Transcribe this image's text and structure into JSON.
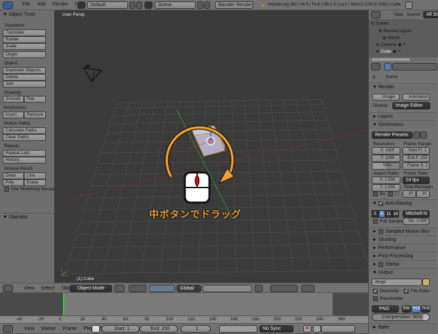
{
  "top": {
    "menus": [
      "File",
      "Add",
      "Render",
      "Help"
    ],
    "layout": "Default",
    "scene": "Scene",
    "engine": "Blender Render",
    "info": "blender.org 262 | Ve:8 | Fa:6 | Ob:1-3 | La:1 | Mem:5.17M (0.10M) | Cube"
  },
  "tools": {
    "title": "Object Tools",
    "transform": "Transform:",
    "translate": "Translate",
    "rotate": "Rotate",
    "scale": "Scale",
    "origin": "Origin",
    "object": "Object:",
    "duplicate": "Duplicate Objects",
    "delete": "Delete",
    "join": "Join",
    "shading": "Shading:",
    "smooth": "Smooth",
    "flat": "Flat",
    "keyframes": "Keyframes:",
    "insert": "Insert",
    "remove": "Remove",
    "motion": "Motion Paths:",
    "calc": "Calculate Paths",
    "clear": "Clear Paths",
    "repeat": "Repeat:",
    "repeat_last": "Repeat Last",
    "history": "History...",
    "grease": "Grease Pencil:",
    "draw": "Draw",
    "line": "Line",
    "poly": "Poly",
    "erase": "Erase",
    "sketch": "Use Sketching Sessio",
    "operator": "Operator"
  },
  "viewport": {
    "label": "User Persp",
    "object_label": "(1) Cube",
    "overlay_text": "中ボタンでドラッグ",
    "accent": "#f0a030"
  },
  "view_header": {
    "menus": [
      "View",
      "Select",
      "Object"
    ],
    "mode": "Object Mode",
    "orientation": "Global"
  },
  "timeline": {
    "ticks": [
      "-40",
      "-20",
      "0",
      "20",
      "40",
      "60",
      "80",
      "100",
      "120",
      "140",
      "160",
      "180",
      "200",
      "220",
      "240",
      "260"
    ],
    "menus": [
      "View",
      "Marker",
      "Frame",
      "Playback"
    ],
    "start": "Start: 1",
    "end": "End: 250",
    "current": "1",
    "sync": "No Sync"
  },
  "outliner": {
    "menus": [
      "View",
      "Search"
    ],
    "filter": "All Scenes",
    "items": [
      "Scene",
      "RenderLayers",
      "World",
      "Camera",
      "Cube"
    ]
  },
  "props": {
    "scene": "Scene",
    "render": "Render",
    "image": "Image",
    "animation": "Animation",
    "display_label": "Display:",
    "display": "Image Editor",
    "layers": "Layers",
    "dimensions": "Dimensions",
    "presets": "Render Presets",
    "resolution": "Resolution:",
    "res_x": "X: 1920",
    "res_y": "Y: 1080",
    "res_pct": "50%",
    "frame_range": "Frame Range:",
    "start": "Start Fr: 1",
    "end": "End F: 250",
    "step": "Frame S: 1",
    "aspect": "Aspect Ratio:",
    "asp_x": "X: 1.000",
    "asp_y": "Y: 1.000",
    "frame_rate": "Frame Rate:",
    "fps": "24 fps",
    "remap": "Time Remappi",
    "remap_old": "10",
    "remap_new": "10",
    "border": "Bo",
    "crop": "Cr",
    "aa": "Anti-Aliasing",
    "aa_samples": [
      "5",
      "8",
      "11",
      "16"
    ],
    "aa_selected": "8",
    "filter": "Mitchell-N",
    "full_sample": "Full Sample",
    "size": "Siz: 1.000",
    "motion_blur": "Sampled Motion Blur",
    "shading": "Shading",
    "performance": "Performance",
    "post": "Post Processing",
    "stamp": "Stamp",
    "output": "Output",
    "path": "/tmp/",
    "overwrite": "Overwrite",
    "file_ext": "File Exten",
    "placeholder": "Placeholder",
    "format": "PNG",
    "bw": "BW",
    "rgb": "RGB",
    "rgba": "RGB",
    "compression": "Compression: 90%",
    "bake": "Bake"
  }
}
